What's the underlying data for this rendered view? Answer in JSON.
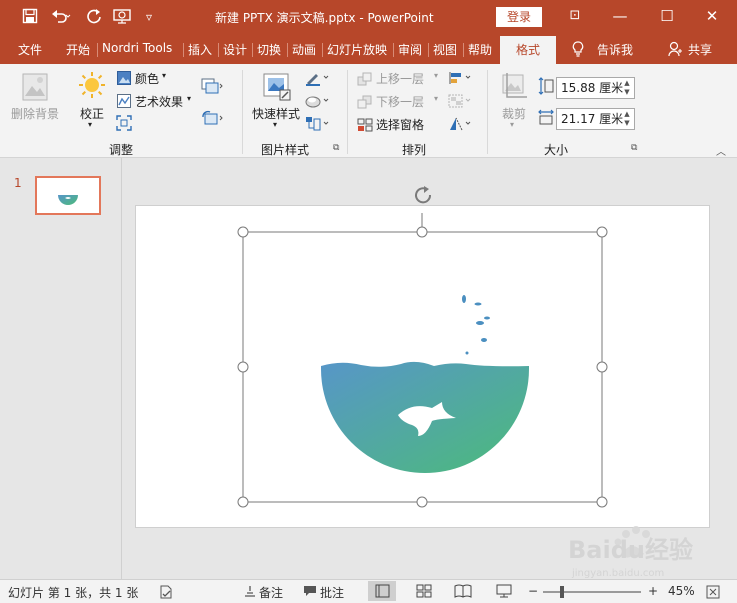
{
  "window": {
    "title": "新建 PPTX 演示文稿.pptx  -  PowerPoint",
    "login_label": "登录",
    "controls": {
      "ribbon_display": "⊡",
      "minimize": "—",
      "maximize": "☐",
      "close": "✕"
    }
  },
  "quick_access": {
    "save": "save-icon",
    "undo": "undo-icon",
    "redo": "redo-icon",
    "present": "present-icon",
    "customize": "▿"
  },
  "menu": {
    "tabs": [
      {
        "label": "文件"
      },
      {
        "label": "开始"
      },
      {
        "label": "Nordri Tools"
      },
      {
        "label": "插入"
      },
      {
        "label": "设计"
      },
      {
        "label": "切换"
      },
      {
        "label": "动画"
      },
      {
        "label": "幻灯片放映"
      },
      {
        "label": "审阅"
      },
      {
        "label": "视图"
      },
      {
        "label": "帮助"
      },
      {
        "label": "格式",
        "active": true
      }
    ],
    "tell_me": "告诉我",
    "share": "共享"
  },
  "ribbon": {
    "adjust": {
      "remove_background": "删除背景",
      "correct": "校正",
      "color": "颜色",
      "artistic_effects": "艺术效果",
      "group_label": "调整"
    },
    "picture_styles": {
      "quick_styles": "快速样式",
      "group_label": "图片样式"
    },
    "arrange": {
      "bring_forward": "上移一层",
      "send_backward": "下移一层",
      "selection_pane": "选择窗格",
      "group_label": "排列"
    },
    "size": {
      "crop": "裁剪",
      "height": "15.88 厘米",
      "width": "21.17 厘米",
      "group_label": "大小"
    }
  },
  "thumbnails": {
    "slide_number": "1"
  },
  "statusbar": {
    "slide_info": "幻灯片 第 1 张，共 1 张",
    "notes": "备注",
    "comments": "批注",
    "zoom_minus": "−",
    "zoom_plus": "+",
    "zoom": "45%",
    "zoom_fraction": 0.45
  },
  "watermark": {
    "brand": "Baidu经验",
    "url": "jingyan.baidu.com"
  },
  "colors": {
    "accent": "#b7472a",
    "bowl_gradient_start": "#5796c8",
    "bowl_gradient_end": "#4cbb7a"
  }
}
